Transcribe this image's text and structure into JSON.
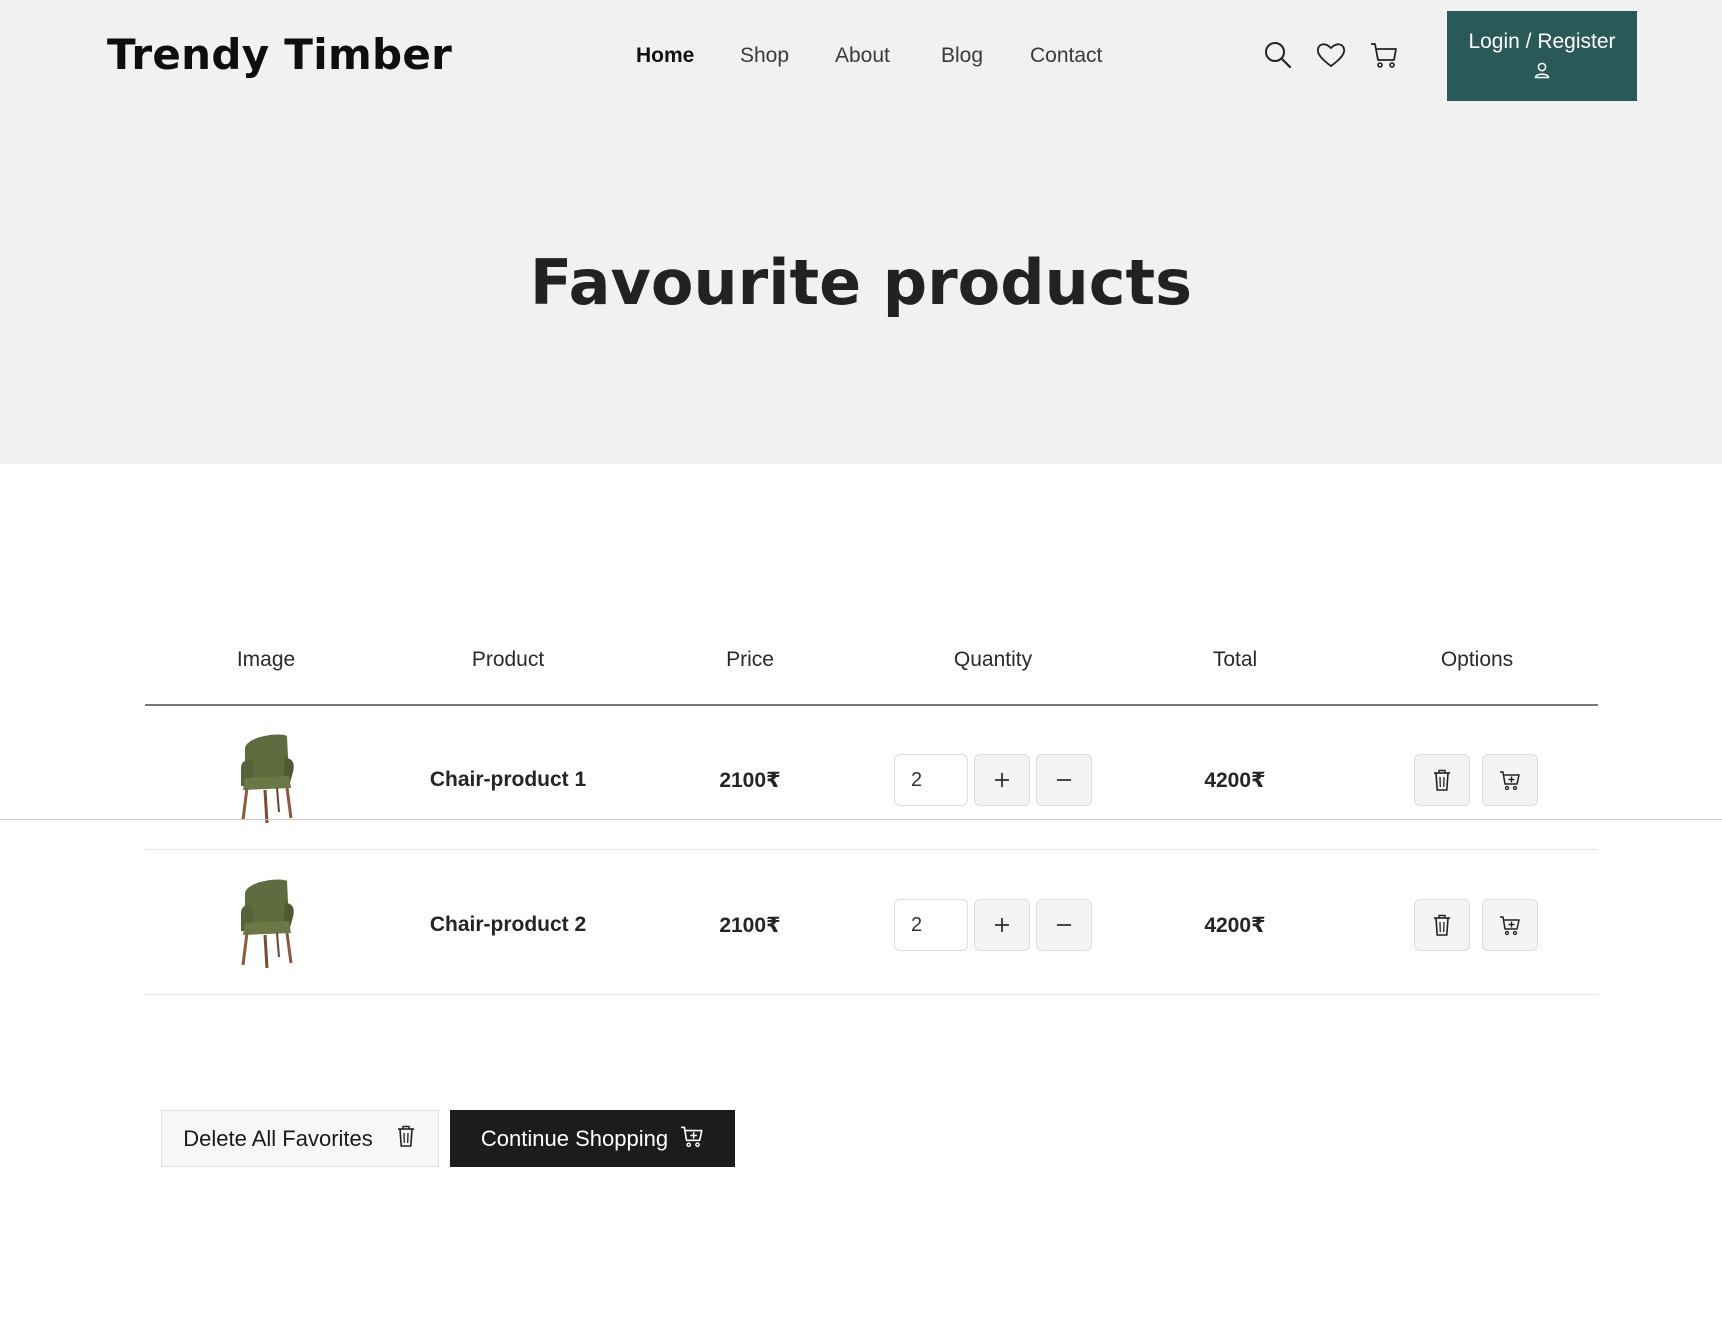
{
  "brand": "Trendy Timber",
  "nav": {
    "items": [
      "Home",
      "Shop",
      "About",
      "Blog",
      "Contact"
    ],
    "active": "Home"
  },
  "header_icons": [
    "search-icon",
    "heart-icon",
    "cart-icon"
  ],
  "login": {
    "label": "Login / Register",
    "icon": "user-icon"
  },
  "accent_color": "#2a5a57",
  "page_title": "Favourite products",
  "table": {
    "columns": [
      "Image",
      "Product",
      "Price",
      "Quantity",
      "Total",
      "Options"
    ],
    "rows": [
      {
        "product": "Chair-product 1",
        "price": "2100₹",
        "quantity": "2",
        "total": "4200₹"
      },
      {
        "product": "Chair-product 2",
        "price": "2100₹",
        "quantity": "2",
        "total": "4200₹"
      }
    ],
    "row_actions": [
      "trash-icon",
      "cart-plus-icon"
    ],
    "quantity_controls": [
      "plus-icon",
      "minus-icon"
    ]
  },
  "actions": {
    "delete_all": "Delete All Favorites",
    "continue_shopping": "Continue Shopping"
  }
}
